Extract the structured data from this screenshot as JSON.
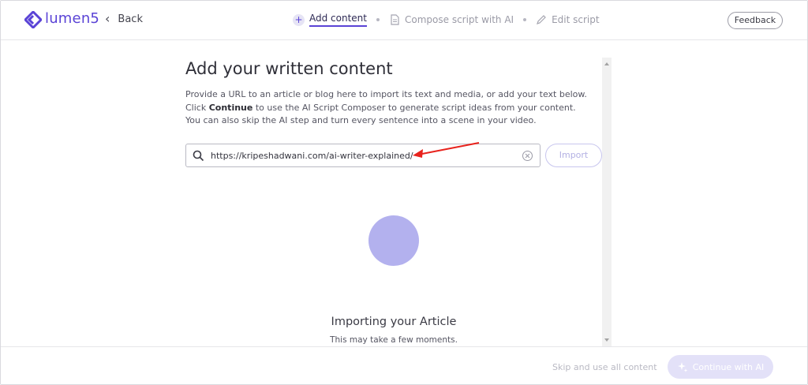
{
  "header": {
    "logo_text": "lumen5",
    "back_label": "Back",
    "steps": [
      {
        "label": "Add content",
        "active": true
      },
      {
        "label": "Compose script with AI",
        "active": false
      },
      {
        "label": "Edit script",
        "active": false
      }
    ],
    "feedback_label": "Feedback"
  },
  "main": {
    "title": "Add your written content",
    "desc_part1": "Provide a URL to an article or blog here to import its text and media, or add your text below. Click ",
    "desc_bold": "Continue",
    "desc_part2": " to use the AI Script Composer to generate script ideas from your content. You can also skip the AI step and turn every sentence into a scene in your video.",
    "url_value": "https://kripeshadwani.com/ai-writer-explained/",
    "import_label": "Import",
    "importing_title": "Importing your Article",
    "importing_sub": "This may take a few moments."
  },
  "footer": {
    "skip_label": "Skip and use all content",
    "continue_label": "Continue with AI"
  },
  "colors": {
    "brand": "#5a43d6",
    "loader": "#b3b1ee",
    "annotation_arrow": "#e8231d"
  }
}
